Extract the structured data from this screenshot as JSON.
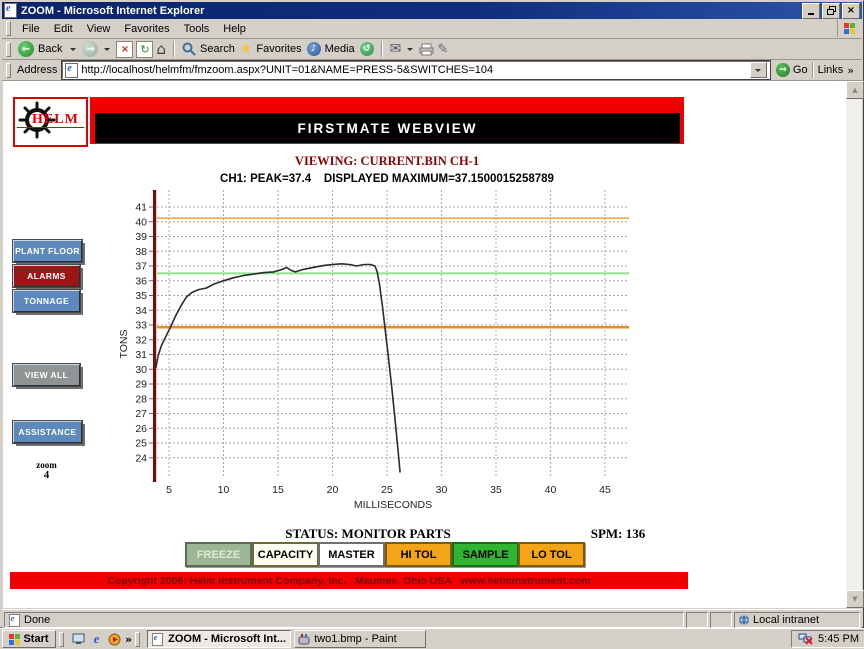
{
  "window_title": "ZOOM - Microsoft Internet Explorer",
  "menu_items": [
    "File",
    "Edit",
    "View",
    "Favorites",
    "Tools",
    "Help"
  ],
  "toolbar": {
    "back": "Back",
    "search": "Search",
    "favorites": "Favorites",
    "media": "Media"
  },
  "address": {
    "label": "Address",
    "url": "http://localhost/helmfm/fmzoom.aspx?UNIT=01&NAME=PRESS-5&SWITCHES=104",
    "go": "Go",
    "links": "Links"
  },
  "page": {
    "logo_text": "HELM",
    "banner_title": "FIRSTMATE WEBVIEW",
    "viewing": "VIEWING: CURRENT.BIN CH-1",
    "peak": "CH1: PEAK=37.4    DISPLAYED MAXIMUM=37.1500015258789",
    "sidebar_buttons": [
      {
        "id": "plant-floor",
        "label": "PLANT FLOOR",
        "bg": "#5d89bd"
      },
      {
        "id": "alarms",
        "label": "ALARMS",
        "bg": "#9b1717"
      },
      {
        "id": "tonnage",
        "label": "TONNAGE",
        "bg": "#5d89bd"
      },
      {
        "id": "view-all",
        "label": "VIEW ALL",
        "bg": "#8e9594"
      },
      {
        "id": "assistance",
        "label": "ASSISTANCE",
        "bg": "#5d89bd"
      }
    ],
    "zoom_label": "zoom",
    "zoom_value": "4",
    "status_text": "STATUS: MONITOR PARTS",
    "spm_text": "SPM: 136",
    "control_buttons": [
      {
        "id": "freeze",
        "label": "FREEZE",
        "bg": "#9db694",
        "fg": "#dfe8d8",
        "border": "#5c6b54"
      },
      {
        "id": "capacity",
        "label": "CAPACITY",
        "bg": "#fdfdf0",
        "fg": "#000000",
        "border": "#6b6b3a"
      },
      {
        "id": "master",
        "label": "MASTER",
        "bg": "#ffffff",
        "fg": "#000000",
        "border": "#6f6f6f"
      },
      {
        "id": "hi-tol",
        "label": "HI TOL",
        "bg": "#f4a418",
        "fg": "#000000",
        "border": "#7c5c0a"
      },
      {
        "id": "sample",
        "label": "SAMPLE",
        "bg": "#31b431",
        "fg": "#000000",
        "border": "#176e17"
      },
      {
        "id": "lo-tol",
        "label": "LO TOL",
        "bg": "#f4a418",
        "fg": "#000000",
        "border": "#7c5c0a"
      }
    ],
    "copyright": "Copyright 2006: Helm Instrument Company, Inc.   Maumee, Ohio USA   www.helminstrument.com"
  },
  "status_bar": {
    "status": "Done",
    "zone": "Local intranet"
  },
  "taskbar": {
    "start": "Start",
    "window1": "ZOOM - Microsoft Int...",
    "window2": "two1.bmp - Paint",
    "time": "5:45 PM"
  },
  "chart_data": {
    "type": "line",
    "title": "",
    "xlabel": "MILLISECONDS",
    "ylabel": "TONS",
    "x_ticks": [
      5,
      10,
      15,
      20,
      25,
      30,
      35,
      40,
      45
    ],
    "y_ticks": [
      24,
      25,
      26,
      27,
      28,
      29,
      30,
      31,
      32,
      33,
      34,
      35,
      36,
      37,
      38,
      39,
      40,
      41
    ],
    "xlim": [
      3.7,
      46.8
    ],
    "ylim": [
      22.4,
      42.1
    ],
    "grid": true,
    "legend": false,
    "reference_lines": [
      {
        "name": "hi-tolerance",
        "value": 40.25,
        "color": "#f2a33c",
        "width": 1.5
      },
      {
        "name": "sample-level",
        "value": 36.5,
        "color": "#8fe18f",
        "width": 2
      },
      {
        "name": "lo-tolerance",
        "value": 32.85,
        "color": "#ec8c1e",
        "width": 2.5
      }
    ],
    "series": [
      {
        "name": "CH1 tonnage curve",
        "color": "#2b2b2b",
        "points": [
          [
            3.8,
            30.1
          ],
          [
            4.0,
            30.9
          ],
          [
            4.3,
            31.6
          ],
          [
            4.7,
            32.2
          ],
          [
            5.1,
            32.8
          ],
          [
            5.6,
            33.6
          ],
          [
            6.1,
            34.3
          ],
          [
            6.6,
            34.9
          ],
          [
            7.1,
            35.2
          ],
          [
            7.7,
            35.4
          ],
          [
            8.4,
            35.5
          ],
          [
            9.2,
            35.8
          ],
          [
            10.0,
            36.0
          ],
          [
            10.9,
            36.2
          ],
          [
            11.8,
            36.35
          ],
          [
            12.8,
            36.45
          ],
          [
            13.7,
            36.55
          ],
          [
            14.6,
            36.6
          ],
          [
            15.3,
            36.75
          ],
          [
            15.8,
            36.9
          ],
          [
            16.2,
            36.7
          ],
          [
            16.6,
            36.6
          ],
          [
            17.2,
            36.75
          ],
          [
            17.9,
            36.85
          ],
          [
            18.6,
            36.95
          ],
          [
            19.3,
            37.05
          ],
          [
            20.0,
            37.1
          ],
          [
            20.8,
            37.15
          ],
          [
            21.6,
            37.1
          ],
          [
            22.2,
            37.0
          ],
          [
            22.9,
            37.1
          ],
          [
            23.5,
            37.1
          ],
          [
            23.9,
            37.0
          ],
          [
            24.1,
            36.6
          ],
          [
            24.3,
            35.8
          ],
          [
            24.6,
            34.2
          ],
          [
            24.8,
            32.9
          ],
          [
            25.1,
            31.0
          ],
          [
            25.4,
            29.0
          ],
          [
            25.7,
            26.9
          ],
          [
            26.0,
            24.6
          ],
          [
            26.2,
            23.0
          ]
        ]
      }
    ]
  }
}
